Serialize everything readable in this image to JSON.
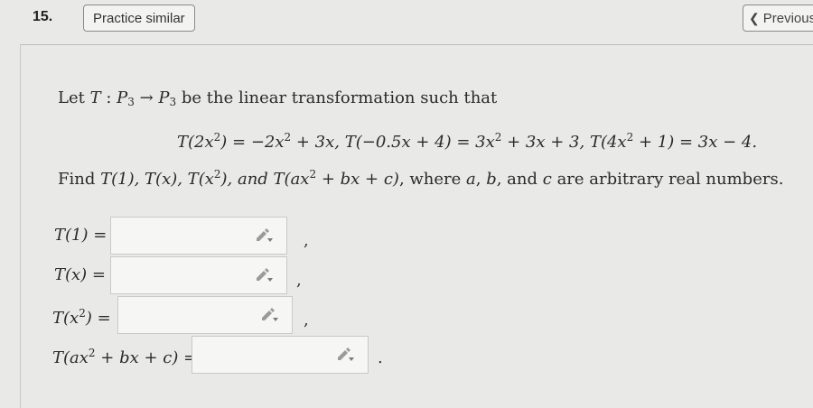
{
  "header": {
    "question_number": "15.",
    "practice_button": "Practice similar",
    "previous_button": "Previous"
  },
  "problem": {
    "intro": {
      "let": "Let",
      "T": "T",
      "colon": " : ",
      "P": "P",
      "dom_sub": "3",
      "arrow": " → ",
      "cod_sub": "3",
      "rest": " be the linear transformation such that"
    },
    "equation": {
      "part1": "T(2x",
      "sup1": "2",
      "part2": ") = −2x",
      "sup2": "2",
      "part3": " + 3x,   T(−0.5x + 4) = 3x",
      "sup3": "2",
      "part4": " + 3x + 3,   T(4x",
      "sup4": "2",
      "part5": " + 1) = 3x − 4."
    },
    "find": {
      "part1": "Find ",
      "t1": "T(1), T(x), T(x",
      "sup": "2",
      "t2": "), and T(ax",
      "sup2": "2",
      "t3": " + bx + c)",
      "part2": ", where ",
      "a": "a",
      "sep1": ", ",
      "b": "b",
      "sep2": ", and ",
      "c": "c",
      "part3": " are arbitrary real numbers."
    }
  },
  "answers": [
    {
      "label": "T(1) =",
      "value": "",
      "separator": ","
    },
    {
      "label": "T(x) =",
      "value": "",
      "separator": ","
    },
    {
      "label_pre": "T(x",
      "label_sup": "2",
      "label_post": ") =",
      "value": "",
      "separator": ","
    },
    {
      "label_pre": "T(ax",
      "label_sup": "2",
      "label_post": " + bx + c) =",
      "value": "",
      "separator": "."
    }
  ],
  "icons": {
    "answer_tool": "pencil-dropdown-icon",
    "previous": "chevron-left-icon"
  }
}
